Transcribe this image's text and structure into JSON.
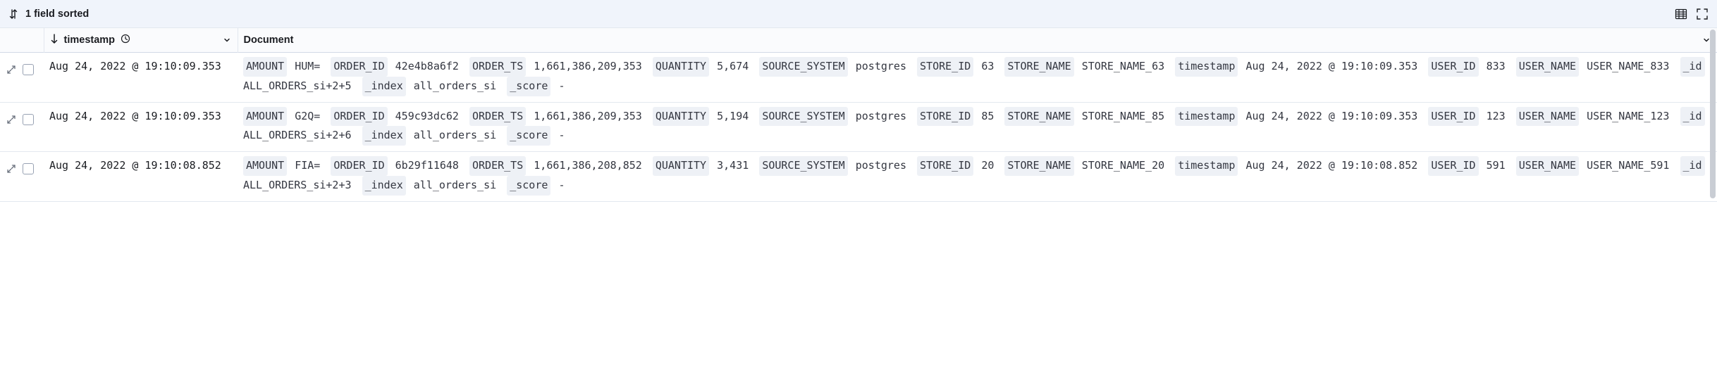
{
  "toolbar": {
    "sort_info": "1 field sorted"
  },
  "columns": {
    "timestamp": "timestamp",
    "document": "Document"
  },
  "rows": [
    {
      "timestamp": "Aug 24, 2022 @ 19:10:09.353",
      "fields": [
        {
          "k": "AMOUNT",
          "v": "HUM="
        },
        {
          "k": "ORDER_ID",
          "v": "42e4b8a6f2"
        },
        {
          "k": "ORDER_TS",
          "v": "1,661,386,209,353"
        },
        {
          "k": "QUANTITY",
          "v": "5,674"
        },
        {
          "k": "SOURCE_SYSTEM",
          "v": "postgres"
        },
        {
          "k": "STORE_ID",
          "v": "63"
        },
        {
          "k": "STORE_NAME",
          "v": "STORE_NAME_63"
        },
        {
          "k": "timestamp",
          "v": "Aug 24, 2022 @ 19:10:09.353"
        },
        {
          "k": "USER_ID",
          "v": "833"
        },
        {
          "k": "USER_NAME",
          "v": "USER_NAME_833"
        },
        {
          "k": "_id",
          "v": "ALL_ORDERS_si+2+5"
        },
        {
          "k": "_index",
          "v": "all_orders_si"
        },
        {
          "k": "_score",
          "v": " - "
        }
      ]
    },
    {
      "timestamp": "Aug 24, 2022 @ 19:10:09.353",
      "fields": [
        {
          "k": "AMOUNT",
          "v": "G2Q="
        },
        {
          "k": "ORDER_ID",
          "v": "459c93dc62"
        },
        {
          "k": "ORDER_TS",
          "v": "1,661,386,209,353"
        },
        {
          "k": "QUANTITY",
          "v": "5,194"
        },
        {
          "k": "SOURCE_SYSTEM",
          "v": "postgres"
        },
        {
          "k": "STORE_ID",
          "v": "85"
        },
        {
          "k": "STORE_NAME",
          "v": "STORE_NAME_85"
        },
        {
          "k": "timestamp",
          "v": "Aug 24, 2022 @ 19:10:09.353"
        },
        {
          "k": "USER_ID",
          "v": "123"
        },
        {
          "k": "USER_NAME",
          "v": "USER_NAME_123"
        },
        {
          "k": "_id",
          "v": "ALL_ORDERS_si+2+6"
        },
        {
          "k": "_index",
          "v": "all_orders_si"
        },
        {
          "k": "_score",
          "v": " - "
        }
      ]
    },
    {
      "timestamp": "Aug 24, 2022 @ 19:10:08.852",
      "fields": [
        {
          "k": "AMOUNT",
          "v": "FIA="
        },
        {
          "k": "ORDER_ID",
          "v": "6b29f11648"
        },
        {
          "k": "ORDER_TS",
          "v": "1,661,386,208,852"
        },
        {
          "k": "QUANTITY",
          "v": "3,431"
        },
        {
          "k": "SOURCE_SYSTEM",
          "v": "postgres"
        },
        {
          "k": "STORE_ID",
          "v": "20"
        },
        {
          "k": "STORE_NAME",
          "v": "STORE_NAME_20"
        },
        {
          "k": "timestamp",
          "v": "Aug 24, 2022 @ 19:10:08.852"
        },
        {
          "k": "USER_ID",
          "v": "591"
        },
        {
          "k": "USER_NAME",
          "v": "USER_NAME_591"
        },
        {
          "k": "_id",
          "v": "ALL_ORDERS_si+2+3"
        },
        {
          "k": "_index",
          "v": "all_orders_si"
        },
        {
          "k": "_score",
          "v": " - "
        }
      ]
    }
  ]
}
